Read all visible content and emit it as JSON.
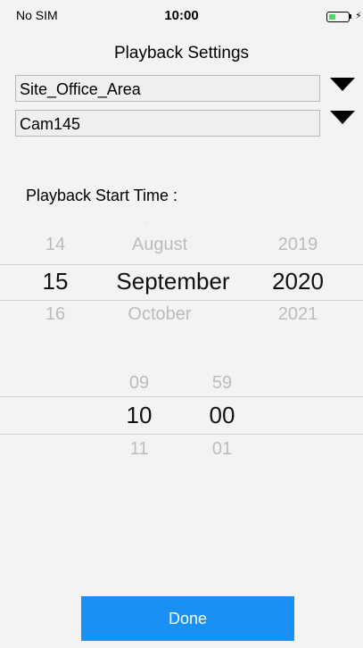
{
  "status_bar": {
    "carrier": "No SIM",
    "time": "10:00",
    "battery_level": 0.35,
    "battery_color": "#4cd964",
    "charging_icon": "bolt-icon"
  },
  "header": {
    "title": "Playback Settings"
  },
  "site_select": {
    "value": "Site_Office_Area",
    "icon": "triangle-down"
  },
  "camera_select": {
    "value": "Cam145",
    "icon": "triangle-down"
  },
  "start_time": {
    "label": "Playback Start Time :"
  },
  "date_picker": {
    "day": {
      "prev": "14",
      "selected": "15",
      "next": "16"
    },
    "month": {
      "prev": "August",
      "selected": "September",
      "next": "October"
    },
    "year": {
      "prev": "2019",
      "selected": "2020",
      "next": "2021"
    }
  },
  "time_picker": {
    "hour": {
      "prev": "09",
      "selected": "10",
      "next": "11"
    },
    "minute": {
      "prev": "59",
      "selected": "00",
      "next": "01"
    }
  },
  "actions": {
    "done_label": "Done",
    "done_color": "#1a90f5"
  }
}
